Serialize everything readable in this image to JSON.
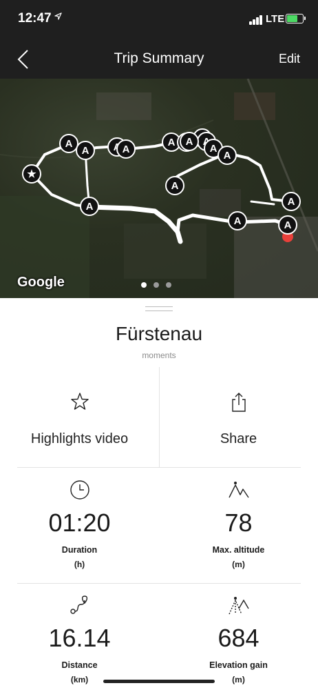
{
  "status": {
    "time": "12:47",
    "location_icon": "location-arrow",
    "network": "LTE",
    "battery_level": 0.7,
    "battery_color": "#4cd964"
  },
  "nav": {
    "back_icon": "chevron-left",
    "title": "Trip Summary",
    "edit_label": "Edit"
  },
  "map": {
    "provider_logo": "Google",
    "page_count": 3,
    "active_page": 1,
    "markers": [
      "★",
      "A",
      "A",
      "A",
      "A",
      "A",
      "A",
      "A",
      "A",
      "A",
      "A",
      "A",
      "A",
      "A",
      "A",
      "A",
      "A"
    ],
    "end_marker_color": "#e8403a"
  },
  "place": {
    "title": "Fürstenau",
    "subtitle": "moments"
  },
  "actions": [
    {
      "icon": "star-icon",
      "label": "Highlights video"
    },
    {
      "icon": "share-icon",
      "label": "Share"
    }
  ],
  "stats": [
    {
      "icon": "clock-icon",
      "value": "01:20",
      "name": "Duration",
      "unit": "(h)"
    },
    {
      "icon": "mountain-peak-icon",
      "value": "78",
      "name": "Max. altitude",
      "unit": "(m)"
    },
    {
      "icon": "route-icon",
      "value": "16.14",
      "name": "Distance",
      "unit": "(km)"
    },
    {
      "icon": "elevation-gain-icon",
      "value": "684",
      "name": "Elevation gain",
      "unit": "(m)"
    }
  ]
}
